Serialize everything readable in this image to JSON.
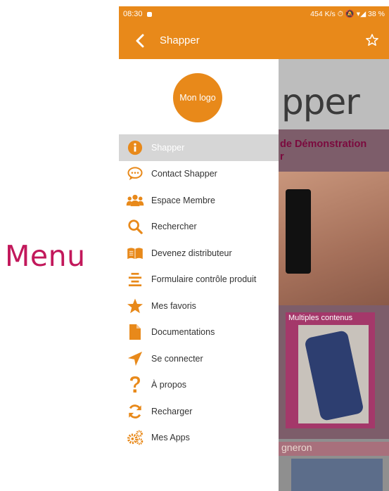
{
  "caption": "Menu",
  "status_bar": {
    "time": "08:30",
    "right": "454 K/s ⏱ 🔕 ▾◢ 38 %"
  },
  "app_bar": {
    "title": "Shapper",
    "back_icon": "chevron-left-icon",
    "star_icon": "star-outline-icon"
  },
  "drawer": {
    "logo": "Mon logo",
    "items": [
      {
        "label": "Shapper",
        "icon": "info-icon",
        "active": true
      },
      {
        "label": "Contact Shapper",
        "icon": "chat-icon",
        "active": false
      },
      {
        "label": "Espace Membre",
        "icon": "users-icon",
        "active": false
      },
      {
        "label": "Rechercher",
        "icon": "search-icon",
        "active": false
      },
      {
        "label": "Devenez distributeur",
        "icon": "book-icon",
        "active": false
      },
      {
        "label": "Formulaire contrôle produit",
        "icon": "form-icon",
        "active": false
      },
      {
        "label": "Mes favoris",
        "icon": "star-icon",
        "active": false
      },
      {
        "label": "Documentations",
        "icon": "document-icon",
        "active": false
      },
      {
        "label": "Se connecter",
        "icon": "location-arrow-icon",
        "active": false
      },
      {
        "label": "À propos",
        "icon": "question-icon",
        "active": false
      },
      {
        "label": "Recharger",
        "icon": "refresh-icon",
        "active": false
      },
      {
        "label": "Mes Apps",
        "icon": "gears-icon",
        "active": false
      }
    ]
  },
  "background": {
    "title": "pper",
    "subtitle": "de Démonstration\nr",
    "multi_label": "Multiples contenus",
    "bottom_label": "gneron"
  },
  "colors": {
    "accent": "#e8891a",
    "caption": "#c2185b",
    "active_row": "#d6d6d6"
  }
}
